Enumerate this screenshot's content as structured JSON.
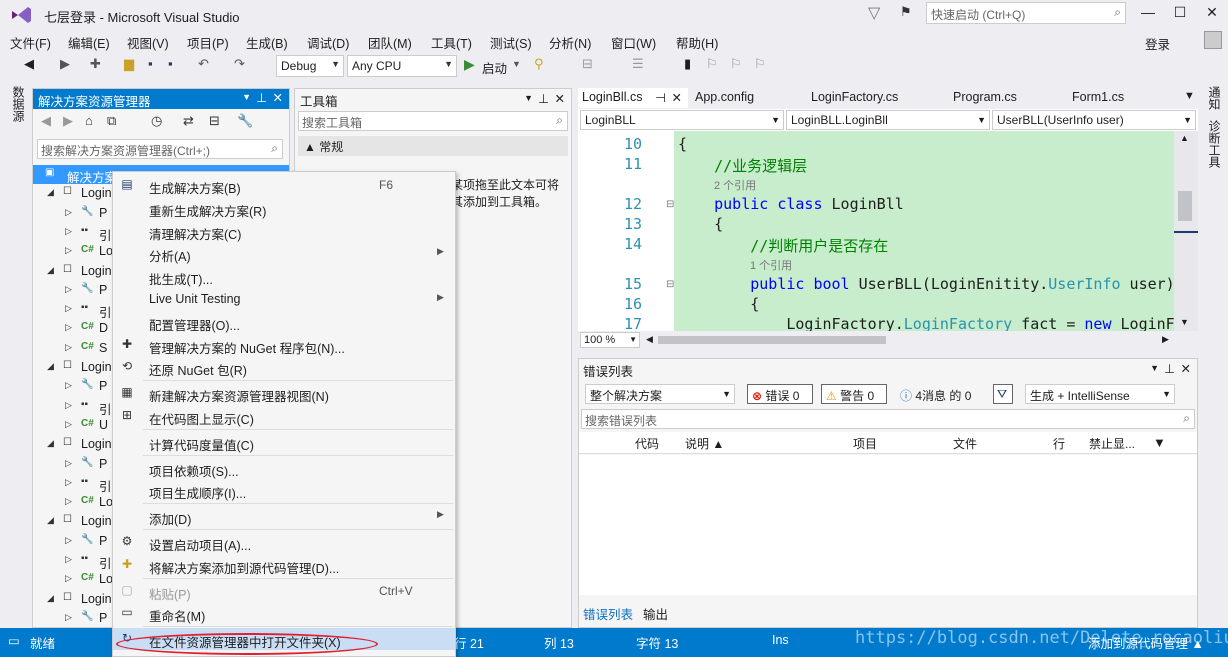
{
  "window": {
    "title": "七层登录 - Microsoft Visual Studio",
    "quick_launch": "快速启动 (Ctrl+Q)"
  },
  "menu": [
    "文件(F)",
    "编辑(E)",
    "视图(V)",
    "项目(P)",
    "生成(B)",
    "调试(D)",
    "团队(M)",
    "工具(T)",
    "测试(S)",
    "分析(N)",
    "窗口(W)",
    "帮助(H)"
  ],
  "signin": "登录",
  "toolbar": {
    "config": "Debug",
    "platform": "Any CPU",
    "start": "启动"
  },
  "side_tabs": {
    "left": "数据源",
    "right1": "通知",
    "right2": "诊断工具"
  },
  "solution_explorer": {
    "title": "解决方案资源管理器",
    "search": "搜索解决方案资源管理器(Ctrl+;)",
    "root": "解决方案",
    "tree": [
      {
        "kind": "proj",
        "label": "Login"
      },
      {
        "kind": "prop",
        "label": "P"
      },
      {
        "kind": "ref",
        "label": "引"
      },
      {
        "kind": "cs",
        "label": "Lo"
      },
      {
        "kind": "proj",
        "label": "Login"
      },
      {
        "kind": "prop",
        "label": "P"
      },
      {
        "kind": "ref",
        "label": "引"
      },
      {
        "kind": "cs",
        "label": "D"
      },
      {
        "kind": "cs",
        "label": "S"
      },
      {
        "kind": "proj",
        "label": "Login"
      },
      {
        "kind": "prop",
        "label": "P"
      },
      {
        "kind": "ref",
        "label": "引"
      },
      {
        "kind": "cs",
        "label": "U"
      },
      {
        "kind": "proj",
        "label": "Login"
      },
      {
        "kind": "prop",
        "label": "P"
      },
      {
        "kind": "ref",
        "label": "引"
      },
      {
        "kind": "cs",
        "label": "Lo"
      },
      {
        "kind": "proj",
        "label": "Login"
      },
      {
        "kind": "prop",
        "label": "P"
      },
      {
        "kind": "ref",
        "label": "引"
      },
      {
        "kind": "cs",
        "label": "Lo"
      },
      {
        "kind": "proj",
        "label": "Login"
      },
      {
        "kind": "prop",
        "label": "P"
      }
    ]
  },
  "toolbox": {
    "title": "工具箱",
    "search": "搜索工具箱",
    "group": "▲ 常规",
    "hint": "某项拖至此文本可将其添加到工具箱。"
  },
  "editor": {
    "tabs": [
      "LoginBll.cs",
      "App.config",
      "LoginFactory.cs",
      "Program.cs",
      "Form1.cs"
    ],
    "nav": [
      "LoginBLL",
      "LoginBLL.LoginBll",
      "UserBLL(UserInfo user)"
    ],
    "zoom": "100 %",
    "lines": [
      {
        "n": "10",
        "code": "{",
        "refs": ""
      },
      {
        "n": "11",
        "code": "    //业务逻辑层",
        "refs": "2 个引用"
      },
      {
        "n": "12",
        "code": "    public class LoginBll",
        "refs": ""
      },
      {
        "n": "13",
        "code": "    {",
        "refs": ""
      },
      {
        "n": "14",
        "code": "        //判断用户是否存在",
        "refs": "1 个引用"
      },
      {
        "n": "15",
        "code": "        public bool UserBLL(LoginEnitity.UserInfo user)",
        "refs": ""
      },
      {
        "n": "16",
        "code": "        {",
        "refs": ""
      },
      {
        "n": "17",
        "code": "            LoginFactory.LoginFactory fact = new LoginF",
        "refs": ""
      }
    ]
  },
  "error_list": {
    "title": "错误列表",
    "scope": "整个解决方案",
    "errors": "错误 0",
    "warnings": "警告 0",
    "messages": "4消息 的 0",
    "build": "生成 + IntelliSense",
    "search": "搜索错误列表",
    "columns": [
      "代码",
      "说明 ▲",
      "项目",
      "文件",
      "行",
      "禁止显..."
    ],
    "tabs": [
      "错误列表",
      "输出"
    ]
  },
  "status": {
    "ready": "就绪",
    "line": "行 21",
    "col": "列 13",
    "char": "字符 13",
    "ins": "Ins",
    "source": "添加到源代码管理 ▲",
    "watermark": "https://blog.csdn.net/Delete_rocaoliu"
  },
  "context_menu": [
    {
      "icon": "build",
      "label": "生成解决方案(B)",
      "shortcut": "F6"
    },
    {
      "icon": "",
      "label": "重新生成解决方案(R)"
    },
    {
      "icon": "",
      "label": "清理解决方案(C)"
    },
    {
      "icon": "",
      "label": "分析(A)",
      "sub": true
    },
    {
      "icon": "",
      "label": "批生成(T)..."
    },
    {
      "icon": "",
      "label": "Live Unit Testing",
      "sub": true
    },
    {
      "icon": "",
      "label": "配置管理器(O)..."
    },
    {
      "icon": "nuget",
      "label": "管理解决方案的 NuGet 程序包(N)..."
    },
    {
      "icon": "restore",
      "label": "还原 NuGet 包(R)"
    },
    {
      "sep": true
    },
    {
      "icon": "view",
      "label": "新建解决方案资源管理器视图(N)"
    },
    {
      "icon": "map",
      "label": "在代码图上显示(C)"
    },
    {
      "sep": true
    },
    {
      "icon": "",
      "label": "计算代码度量值(C)"
    },
    {
      "sep": true
    },
    {
      "icon": "",
      "label": "项目依赖项(S)..."
    },
    {
      "icon": "",
      "label": "项目生成顺序(I)..."
    },
    {
      "sep": true
    },
    {
      "icon": "",
      "label": "添加(D)",
      "sub": true
    },
    {
      "sep": true
    },
    {
      "icon": "gear",
      "label": "设置启动项目(A)..."
    },
    {
      "icon": "sc",
      "label": "将解决方案添加到源代码管理(D)..."
    },
    {
      "sep": true
    },
    {
      "icon": "paste",
      "label": "粘贴(P)",
      "shortcut": "Ctrl+V",
      "disabled": true
    },
    {
      "icon": "rename",
      "label": "重命名(M)"
    },
    {
      "sep": true
    },
    {
      "icon": "folder",
      "label": "在文件资源管理器中打开文件夹(X)",
      "highlight": true
    }
  ]
}
